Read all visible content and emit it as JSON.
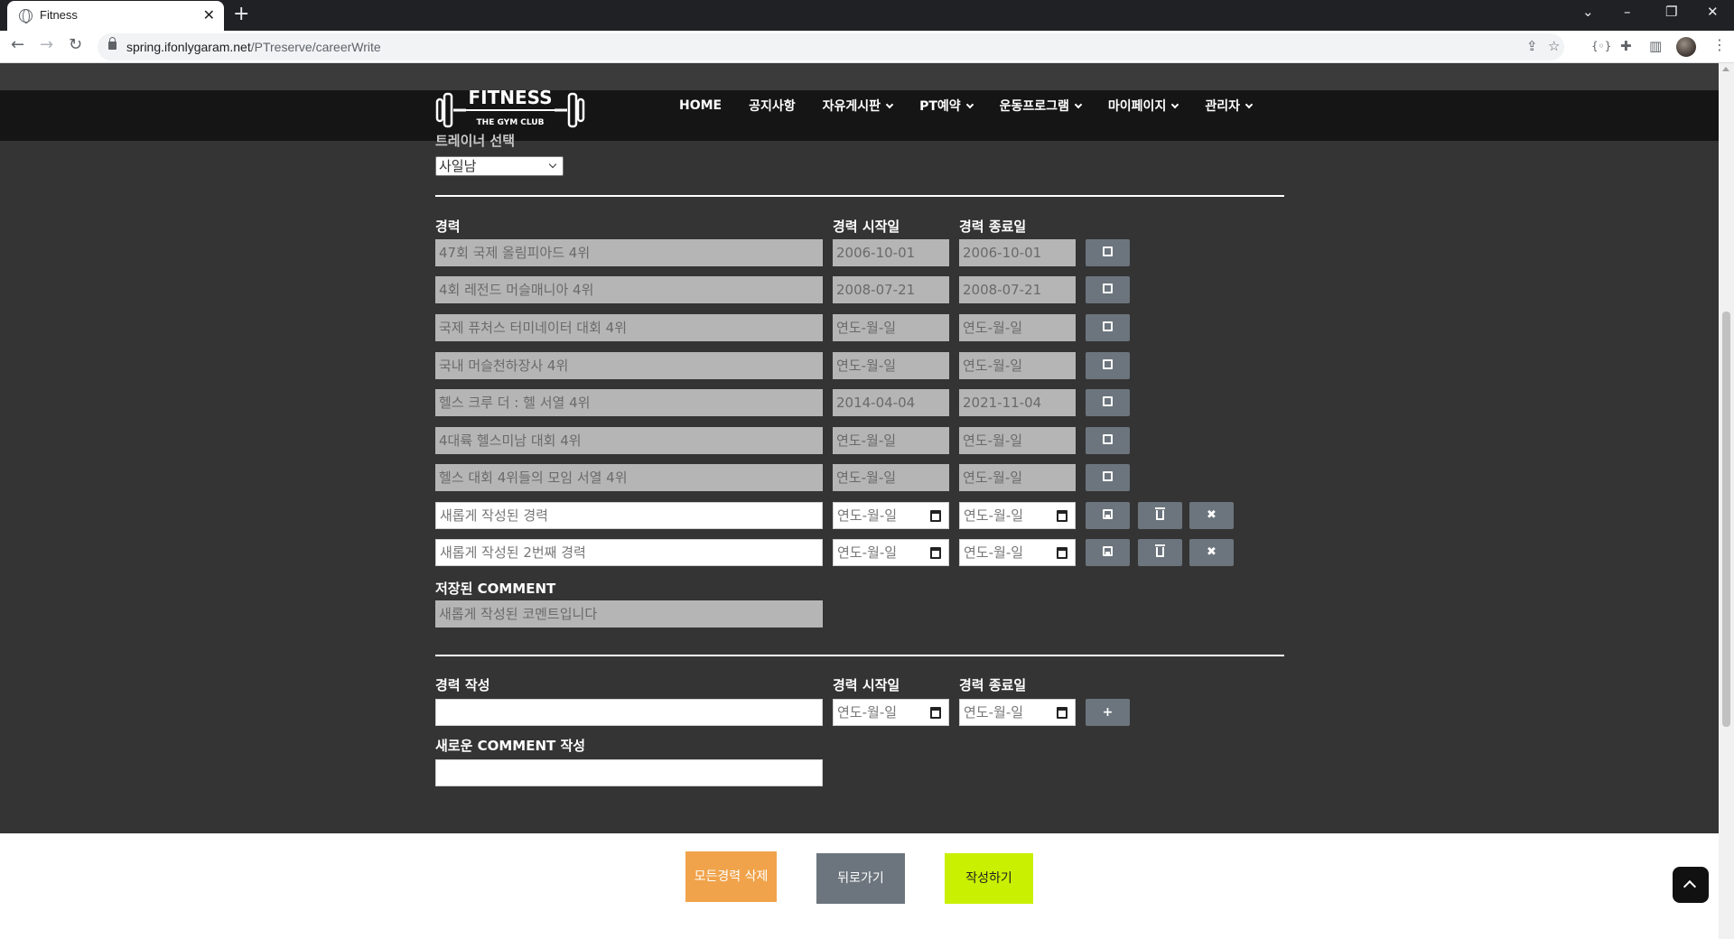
{
  "browser": {
    "tab_title": "Fitness",
    "tab_close": "✕",
    "new_tab": "+",
    "url_host": "spring.ifonlygaram.net",
    "url_path": "/PTreserve/careerWrite",
    "window_controls": [
      "⌄",
      "–",
      "❐",
      "✕"
    ],
    "nav": {
      "back": "←",
      "forward": "→",
      "reload": "↻"
    }
  },
  "header": {
    "logo_text": "FITNESS",
    "logo_sub": "THE GYM CLUB",
    "nav": [
      {
        "label": "HOME",
        "has_dropdown": false
      },
      {
        "label": "공지사항",
        "has_dropdown": false
      },
      {
        "label": "자유게시판",
        "has_dropdown": true
      },
      {
        "label": "PT예약",
        "has_dropdown": true
      },
      {
        "label": "운동프로그램",
        "has_dropdown": true
      },
      {
        "label": "마이페이지",
        "has_dropdown": true
      },
      {
        "label": "관리자",
        "has_dropdown": true
      }
    ]
  },
  "form": {
    "trainer_label": "트레이너 선택",
    "trainer_selected": "사일남",
    "col_career": "경력",
    "col_start": "경력 시작일",
    "col_end": "경력 종료일",
    "saved_careers": [
      {
        "career": "47회 국제 올림피아드 4위",
        "start": "2006-10-01",
        "end": "2006-10-01"
      },
      {
        "career": "4회 레전드 머슬매니아 4위",
        "start": "2008-07-21",
        "end": "2008-07-21"
      },
      {
        "career": "국제 퓨처스 터미네이터 대회 4위",
        "start": "연도-월-일",
        "end": "연도-월-일"
      },
      {
        "career": "국내 머슬천하장사 4위",
        "start": "연도-월-일",
        "end": "연도-월-일"
      },
      {
        "career": "헬스 크루 더 : 헬 서열 4위",
        "start": "2014-04-04",
        "end": "2021-11-04"
      },
      {
        "career": "4대륙 헬스미남 대회 4위",
        "start": "연도-월-일",
        "end": "연도-월-일"
      },
      {
        "career": "헬스 대회 4위들의 모임 서열 4위",
        "start": "연도-월-일",
        "end": "연도-월-일"
      }
    ],
    "editing_careers": [
      {
        "career": "새롭게 작성된 경력",
        "start": "연도-월-일",
        "end": "연도-월-일"
      },
      {
        "career": "새롭게 작성된 2번째 경력",
        "start": "연도-월-일",
        "end": "연도-월-일"
      }
    ],
    "saved_comment_label": "저장된 COMMENT",
    "saved_comment": "새롭게 작성된 코멘트입니다",
    "new_career_label": "경력 작성",
    "new_start_label": "경력 시작일",
    "new_end_label": "경력 종료일",
    "new_career_value": "",
    "new_start_value": "연도-월-일",
    "new_end_value": "연도-월-일",
    "add_label": "+",
    "new_comment_label": "새로운 COMMENT 작성",
    "new_comment_value": ""
  },
  "buttons": {
    "delete_all": "모든경력 삭제",
    "back": "뒤로가기",
    "write": "작성하기",
    "remove_glyph": "✖"
  },
  "colors": {
    "page_dark": "#343434",
    "header_dark": "#151515",
    "readonly_field": "#b5b5b5",
    "btn_gray": "#6c757d",
    "btn_orange": "#f0a34b",
    "btn_lime": "#c8f000"
  }
}
